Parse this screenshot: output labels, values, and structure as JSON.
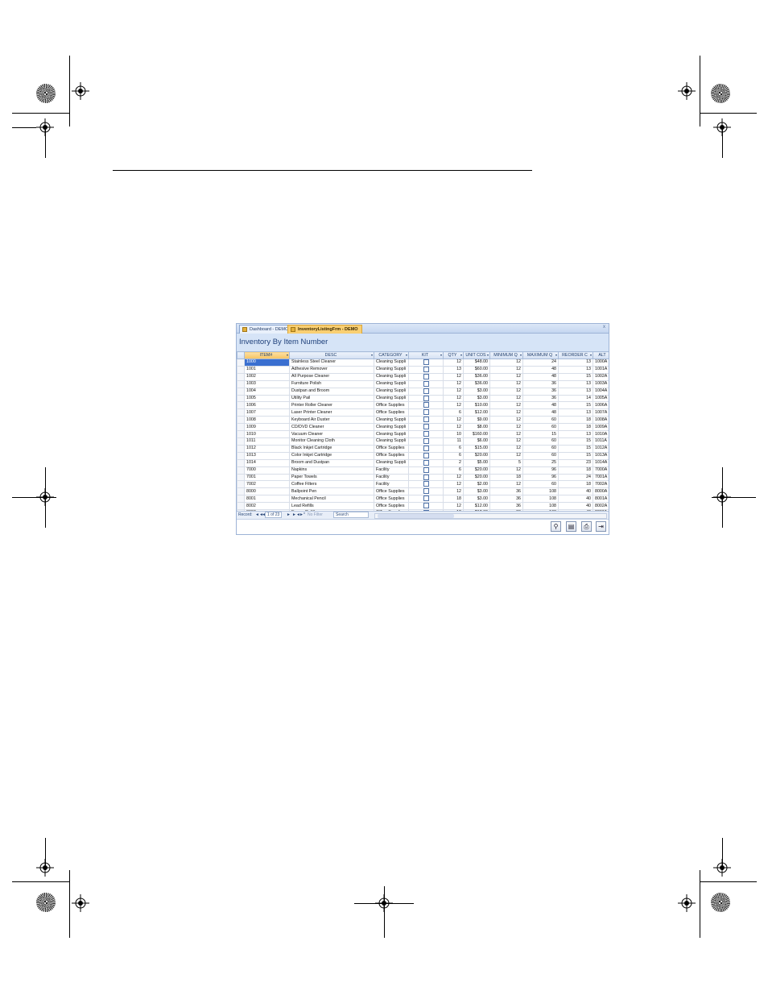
{
  "window": {
    "tabs": [
      {
        "label": "Dashboard - DEMO"
      },
      {
        "label": "InventoryListingFrm - DEMO"
      }
    ],
    "close_glyph": "x",
    "form_title": "Inventory By Item Number"
  },
  "table": {
    "columns": [
      "ITEM#",
      "DESC",
      "CATEGORY",
      "KIT",
      "QTY",
      "UNIT COS",
      "MINIMUM Q",
      "MAXIMUM Q",
      "REORDER C",
      "ALT"
    ],
    "rows": [
      [
        "1000",
        "Stainless Steel Cleaner",
        "Cleaning Suppli",
        "12",
        "$48.00",
        "12",
        "24",
        "13",
        "1000A"
      ],
      [
        "1001",
        "Adhesive Remover",
        "Cleaning Suppli",
        "13",
        "$60.00",
        "12",
        "48",
        "13",
        "1001A"
      ],
      [
        "1002",
        "All Purpose Cleaner",
        "Cleaning Suppli",
        "12",
        "$36.00",
        "12",
        "48",
        "15",
        "1002A"
      ],
      [
        "1003",
        "Furniture Polish",
        "Cleaning Suppli",
        "12",
        "$36.00",
        "12",
        "36",
        "13",
        "1003A"
      ],
      [
        "1004",
        "Dustpan and Broom",
        "Cleaning Suppli",
        "12",
        "$3.00",
        "12",
        "36",
        "13",
        "1004A"
      ],
      [
        "1005",
        "Utility Pail",
        "Cleaning Suppli",
        "12",
        "$3.00",
        "12",
        "36",
        "14",
        "1005A"
      ],
      [
        "1006",
        "Printer Roller Cleaner",
        "Office Supplies",
        "12",
        "$10.00",
        "12",
        "48",
        "15",
        "1006A"
      ],
      [
        "1007",
        "Laser Printer Cleaner",
        "Office Supplies",
        "6",
        "$12.00",
        "12",
        "48",
        "13",
        "1007A"
      ],
      [
        "1008",
        "Keyboard Air Duster",
        "Cleaning Suppli",
        "12",
        "$9.00",
        "12",
        "60",
        "18",
        "1008A"
      ],
      [
        "1009",
        "CD/DVD Cleaner",
        "Cleaning Suppli",
        "12",
        "$8.00",
        "12",
        "60",
        "18",
        "1009A"
      ],
      [
        "1010",
        "Vacuum Cleaner",
        "Cleaning Suppli",
        "10",
        "$160.00",
        "12",
        "15",
        "13",
        "1010A"
      ],
      [
        "1011",
        "Monitor Cleaning Cloth",
        "Cleaning Suppli",
        "11",
        "$6.00",
        "12",
        "60",
        "15",
        "1011A"
      ],
      [
        "1012",
        "Black Inkjet Cartridge",
        "Office Supplies",
        "6",
        "$15.00",
        "12",
        "60",
        "15",
        "1012A"
      ],
      [
        "1013",
        "Color Inkjet Cartridge",
        "Office Supplies",
        "6",
        "$20.00",
        "12",
        "60",
        "15",
        "1013A"
      ],
      [
        "1014",
        "Broom and Dustpan",
        "Cleaning Suppli",
        "2",
        "$5.00",
        "5",
        "25",
        "23",
        "1014A"
      ],
      [
        "7000",
        "Napkins",
        "Facility",
        "6",
        "$20.00",
        "12",
        "96",
        "18",
        "7000A"
      ],
      [
        "7001",
        "Paper Towels",
        "Facility",
        "12",
        "$20.00",
        "18",
        "96",
        "24",
        "7001A"
      ],
      [
        "7002",
        "Coffee Filters",
        "Facility",
        "12",
        "$2.00",
        "12",
        "60",
        "18",
        "7002A"
      ],
      [
        "8000",
        "Ballpoint Pen",
        "Office Supplies",
        "12",
        "$3.00",
        "36",
        "108",
        "40",
        "8000A"
      ],
      [
        "8001",
        "Mechanical Pencil",
        "Office Supplies",
        "18",
        "$3.00",
        "36",
        "108",
        "40",
        "8001A"
      ],
      [
        "8002",
        "Lead Refills",
        "Office Supplies",
        "12",
        "$12.00",
        "36",
        "108",
        "40",
        "8002A"
      ],
      [
        "8003",
        "Eraser Refills",
        "Office Supplies",
        "12",
        "$12.00",
        "36",
        "108",
        "40",
        "8003A"
      ],
      [
        "8004",
        "Wood Pencils",
        "Office Supplies",
        "13",
        "$12.00",
        "36",
        "108",
        "40",
        "8004A"
      ]
    ]
  },
  "navbar": {
    "record_label": "Record:",
    "first_glyph": "◄◄",
    "prev_glyph": "◄",
    "position": "1 of 23",
    "next_glyph": "►",
    "last_glyph": "►◄",
    "new_glyph": "►*",
    "filter_label": "No Filter",
    "search_label": "Search"
  },
  "toolbar": {
    "buttons": [
      {
        "icon": "binoculars-icon",
        "glyph": "⚲"
      },
      {
        "icon": "preview-icon",
        "glyph": "▤"
      },
      {
        "icon": "print-icon",
        "glyph": "⎙"
      },
      {
        "icon": "close-form-icon",
        "glyph": "⇥"
      }
    ]
  }
}
